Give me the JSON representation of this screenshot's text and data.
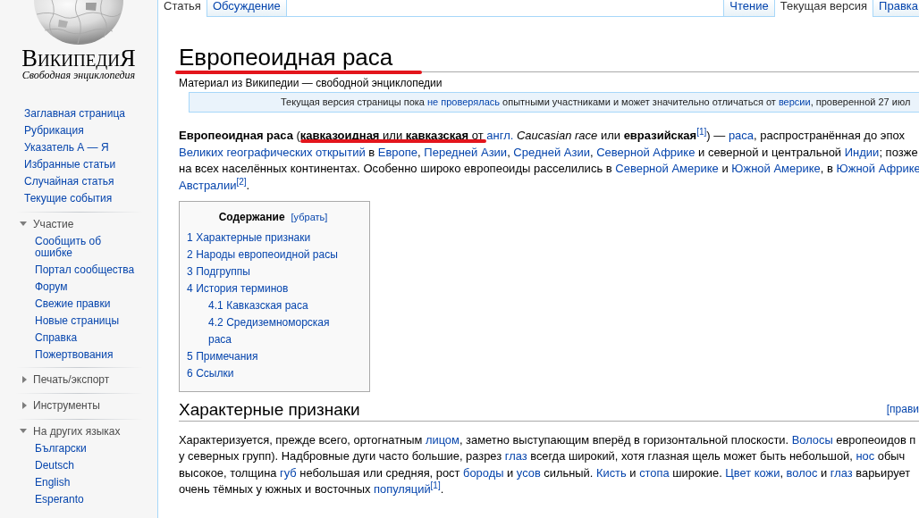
{
  "sidebar": {
    "logo": {
      "wordmark": "ВикипедиЯ",
      "tagline": "Свободная энциклопедия"
    },
    "navigation": [
      "Заглавная страница",
      "Рубрикация",
      "Указатель А — Я",
      "Избранные статьи",
      "Случайная статья",
      "Текущие события"
    ],
    "portlets": [
      {
        "heading": "Участие",
        "expanded": true,
        "items": [
          "Сообщить об ошибке",
          "Портал сообщества",
          "Форум",
          "Свежие правки",
          "Новые страницы",
          "Справка",
          "Пожертвования"
        ]
      },
      {
        "heading": "Печать/экспорт",
        "expanded": false
      },
      {
        "heading": "Инструменты",
        "expanded": false
      },
      {
        "heading": "На других языках",
        "expanded": true,
        "items": [
          "Български",
          "Deutsch",
          "English",
          "Esperanto"
        ]
      }
    ]
  },
  "tabs": {
    "namespaces": [
      {
        "label": "Статья",
        "selected": true
      },
      {
        "label": "Обсуждение",
        "selected": false
      }
    ],
    "views": [
      {
        "label": "Чтение",
        "selected": false
      },
      {
        "label": "Текущая версия",
        "selected": true
      },
      {
        "label": "Правка",
        "selected": false
      }
    ]
  },
  "article": {
    "title": {
      "text": "Европеоидная раса",
      "marked": true
    },
    "subtitle": "Материал из Википедии — свободной энциклопедии",
    "notice": [
      {
        "kind": "text",
        "text": "Текущая версия страницы пока "
      },
      {
        "kind": "link",
        "text": "не проверялась"
      },
      {
        "kind": "text",
        "text": " опытными участниками и может значительно отличаться от "
      },
      {
        "kind": "link",
        "text": "версии"
      },
      {
        "kind": "text",
        "text": ", проверенной 27 июл"
      }
    ],
    "intro": [
      [
        {
          "kind": "bold",
          "text": "Европеоидная раса"
        },
        {
          "kind": "text",
          "text": " ("
        },
        {
          "kind": "marked",
          "runs": [
            {
              "kind": "bold",
              "text": "кавказоидная"
            },
            {
              "kind": "text",
              "text": " или "
            },
            {
              "kind": "bold",
              "text": "кавказская"
            },
            {
              "kind": "text",
              "text": " от "
            }
          ]
        },
        {
          "kind": "link",
          "text": "англ."
        },
        {
          "kind": "italic",
          "text": " Caucasian race"
        },
        {
          "kind": "text",
          "text": " или "
        },
        {
          "kind": "bold",
          "text": "евразийская"
        },
        {
          "kind": "ref",
          "text": "[1]"
        },
        {
          "kind": "text",
          "text": ") — "
        },
        {
          "kind": "link",
          "text": "раса"
        },
        {
          "kind": "text",
          "text": ", распространённая до эпох"
        }
      ],
      [
        {
          "kind": "link",
          "text": "Великих географических открытий"
        },
        {
          "kind": "text",
          "text": " в "
        },
        {
          "kind": "link",
          "text": "Европе"
        },
        {
          "kind": "text",
          "text": ", "
        },
        {
          "kind": "link",
          "text": "Передней Азии"
        },
        {
          "kind": "text",
          "text": ", "
        },
        {
          "kind": "link",
          "text": "Средней Азии"
        },
        {
          "kind": "text",
          "text": ", "
        },
        {
          "kind": "link",
          "text": "Северной Африке"
        },
        {
          "kind": "text",
          "text": " и северной и центральной "
        },
        {
          "kind": "link",
          "text": "Индии"
        },
        {
          "kind": "text",
          "text": "; позже"
        }
      ],
      [
        {
          "kind": "text",
          "text": "на всех населённых континентах. Особенно широко европеоиды расселились в "
        },
        {
          "kind": "link",
          "text": "Северной Америке"
        },
        {
          "kind": "text",
          "text": " и "
        },
        {
          "kind": "link",
          "text": "Южной Америке"
        },
        {
          "kind": "text",
          "text": ", в "
        },
        {
          "kind": "link",
          "text": "Южной Африке"
        }
      ],
      [
        {
          "kind": "link",
          "text": "Австралии"
        },
        {
          "kind": "ref",
          "text": "[2]"
        },
        {
          "kind": "text",
          "text": "."
        }
      ]
    ],
    "toc": {
      "title": "Содержание",
      "toggle": "[убрать]",
      "items": [
        {
          "number": "1",
          "text": "Характерные признаки"
        },
        {
          "number": "2",
          "text": "Народы европеоидной расы"
        },
        {
          "number": "3",
          "text": "Подгруппы"
        },
        {
          "number": "4",
          "text": "История терминов",
          "children": [
            {
              "number": "4.1",
              "text": "Кавказская раса"
            },
            {
              "number": "4.2",
              "text": "Средиземноморская раса"
            }
          ]
        },
        {
          "number": "5",
          "text": "Примечания"
        },
        {
          "number": "6",
          "text": "Ссылки"
        }
      ]
    },
    "sections": [
      {
        "heading": "Характерные признаки",
        "edit_link": "[прави",
        "lines": [
          [
            {
              "kind": "text",
              "text": "Характеризуется, прежде всего, ортогнатным "
            },
            {
              "kind": "link",
              "text": "лицом"
            },
            {
              "kind": "text",
              "text": ", заметно выступающим вперёд в горизонтальной плоскости. "
            },
            {
              "kind": "link",
              "text": "Волосы"
            },
            {
              "kind": "text",
              "text": " европеоидов п"
            }
          ],
          [
            {
              "kind": "text",
              "text": "у северных групп). Надбровные дуги часто большие, разрез "
            },
            {
              "kind": "link",
              "text": "глаз"
            },
            {
              "kind": "text",
              "text": " всегда широкий, хотя глазная щель может быть небольшой, "
            },
            {
              "kind": "link",
              "text": "нос"
            },
            {
              "kind": "text",
              "text": " обыч"
            }
          ],
          [
            {
              "kind": "text",
              "text": "высокое, толщина "
            },
            {
              "kind": "link",
              "text": "губ"
            },
            {
              "kind": "text",
              "text": " небольшая или средняя, рост "
            },
            {
              "kind": "link",
              "text": "бороды"
            },
            {
              "kind": "text",
              "text": " и "
            },
            {
              "kind": "link",
              "text": "усов"
            },
            {
              "kind": "text",
              "text": " сильный. "
            },
            {
              "kind": "link",
              "text": "Кисть"
            },
            {
              "kind": "text",
              "text": " и "
            },
            {
              "kind": "link",
              "text": "стопа"
            },
            {
              "kind": "text",
              "text": " широкие. "
            },
            {
              "kind": "link",
              "text": "Цвет кожи"
            },
            {
              "kind": "text",
              "text": ", "
            },
            {
              "kind": "link",
              "text": "волос"
            },
            {
              "kind": "text",
              "text": " и "
            },
            {
              "kind": "link",
              "text": "глаз"
            },
            {
              "kind": "text",
              "text": " варьирует"
            }
          ],
          [
            {
              "kind": "text",
              "text": "очень тёмных у южных и восточных "
            },
            {
              "kind": "link",
              "text": "популяций"
            },
            {
              "kind": "ref",
              "text": "[1]"
            },
            {
              "kind": "text",
              "text": "."
            }
          ]
        ]
      }
    ]
  }
}
